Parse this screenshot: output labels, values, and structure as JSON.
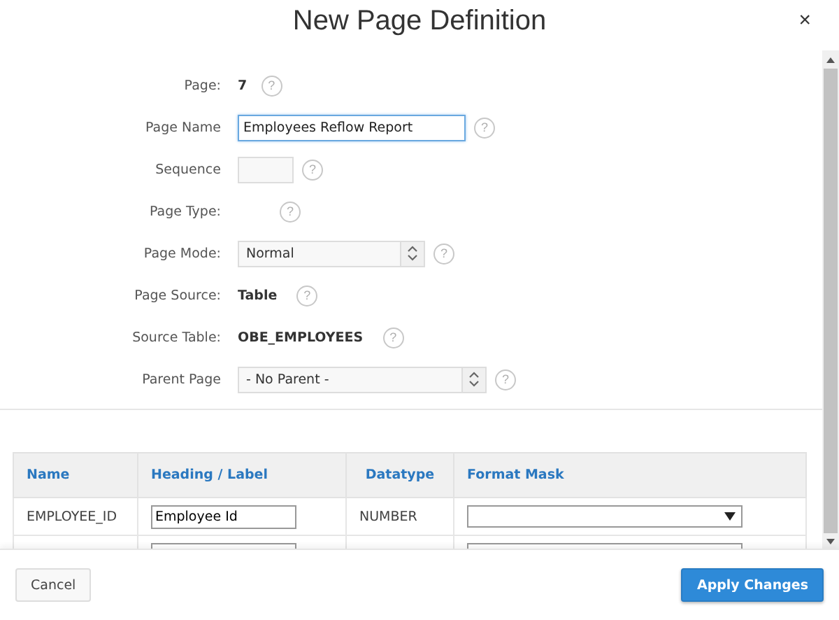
{
  "dialog": {
    "title": "New Page Definition",
    "close": "×"
  },
  "form": {
    "fields": [
      {
        "kind": "static",
        "label": "Page:",
        "value": "7",
        "help": "?"
      },
      {
        "kind": "text",
        "label": "Page Name",
        "value": "Employees Reflow Report",
        "focused": true,
        "help": "?"
      },
      {
        "kind": "text",
        "label": "Sequence",
        "focused": false,
        "help": "?"
      },
      {
        "kind": "static",
        "label": "Page Type:",
        "help": "?"
      },
      {
        "kind": "select",
        "label": "Page Mode:",
        "value": "Normal",
        "help": "?"
      },
      {
        "kind": "static",
        "label": "Page Source:",
        "value": "Table",
        "help": "?"
      },
      {
        "kind": "static",
        "label": "Source Table:",
        "value": "OBE_EMPLOYEES",
        "help": "?"
      },
      {
        "kind": "select",
        "label": "Parent Page",
        "value": "- No Parent -",
        "help": "?"
      }
    ]
  },
  "table": {
    "columns": [
      "Name",
      "Heading / Label",
      "Datatype",
      "Format Mask"
    ],
    "rows": [
      {
        "name": "EMPLOYEE_ID",
        "heading": "Employee Id",
        "datatype": "NUMBER"
      },
      {}
    ]
  },
  "buttons": [
    {
      "label": "Cancel",
      "kind": "secondary"
    },
    {
      "label": "Apply Changes",
      "kind": "primary"
    }
  ]
}
